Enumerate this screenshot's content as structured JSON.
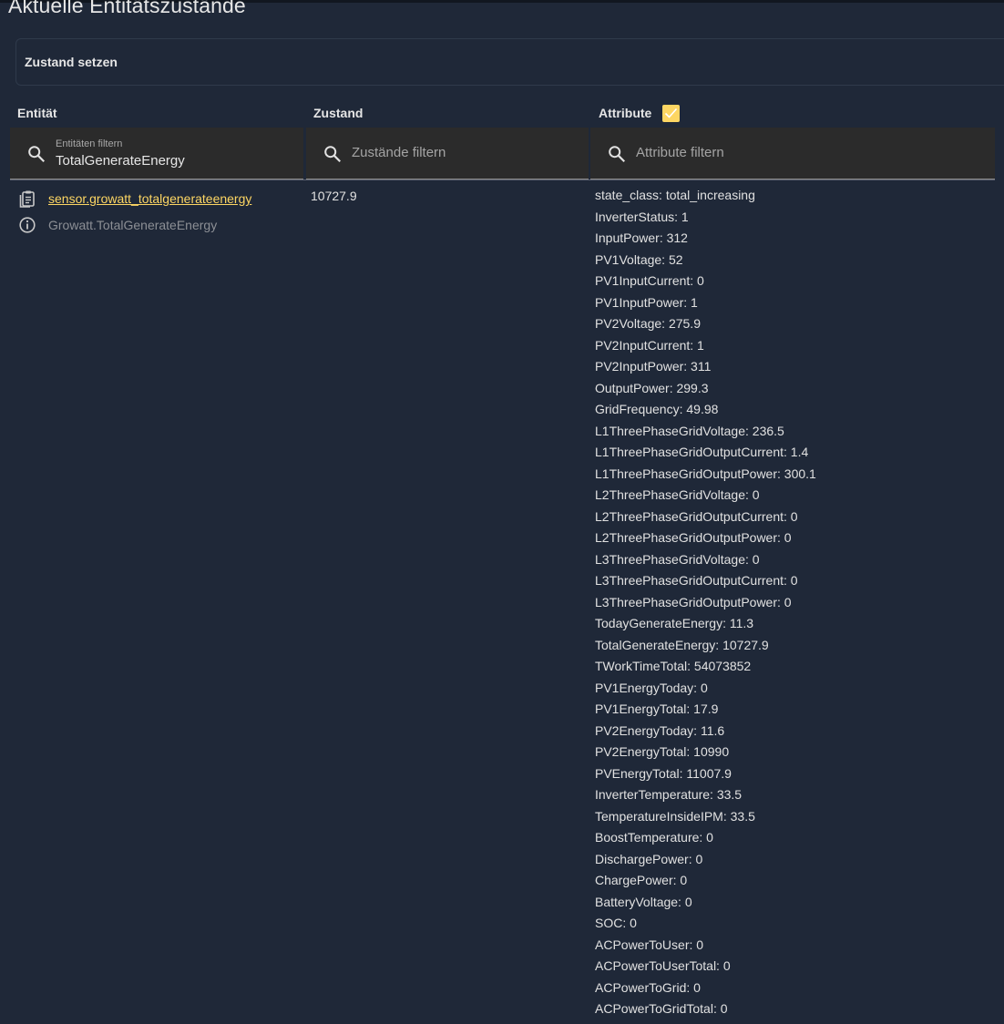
{
  "page": {
    "title": "Aktuelle Entitätszustände"
  },
  "set_state": {
    "label": "Zustand setzen"
  },
  "columns": {
    "entity": "Entität",
    "state": "Zustand",
    "attributes": "Attribute",
    "attributes_checked": true
  },
  "filters": {
    "entity": {
      "label": "Entitäten filtern",
      "value": "TotalGenerateEnergy"
    },
    "state": {
      "placeholder": "Zustände filtern"
    },
    "attributes": {
      "placeholder": "Attribute filtern"
    }
  },
  "colors": {
    "accent": "#fdd663",
    "background": "#1f2838",
    "filter_bg": "#2b2b2b"
  },
  "entity_row": {
    "entity_id": "sensor.growatt_totalgenerateenergy",
    "friendly_name": "Growatt.TotalGenerateEnergy",
    "state": "10727.9",
    "icons": [
      "clipboard-icon",
      "info-icon"
    ],
    "attributes": [
      "state_class: total_increasing",
      "InverterStatus: 1",
      "InputPower: 312",
      "PV1Voltage: 52",
      "PV1InputCurrent: 0",
      "PV1InputPower: 1",
      "PV2Voltage: 275.9",
      "PV2InputCurrent: 1",
      "PV2InputPower: 311",
      "OutputPower: 299.3",
      "GridFrequency: 49.98",
      "L1ThreePhaseGridVoltage: 236.5",
      "L1ThreePhaseGridOutputCurrent: 1.4",
      "L1ThreePhaseGridOutputPower: 300.1",
      "L2ThreePhaseGridVoltage: 0",
      "L2ThreePhaseGridOutputCurrent: 0",
      "L2ThreePhaseGridOutputPower: 0",
      "L3ThreePhaseGridVoltage: 0",
      "L3ThreePhaseGridOutputCurrent: 0",
      "L3ThreePhaseGridOutputPower: 0",
      "TodayGenerateEnergy: 11.3",
      "TotalGenerateEnergy: 10727.9",
      "TWorkTimeTotal: 54073852",
      "PV1EnergyToday: 0",
      "PV1EnergyTotal: 17.9",
      "PV2EnergyToday: 11.6",
      "PV2EnergyTotal: 10990",
      "PVEnergyTotal: 11007.9",
      "InverterTemperature: 33.5",
      "TemperatureInsideIPM: 33.5",
      "BoostTemperature: 0",
      "DischargePower: 0",
      "ChargePower: 0",
      "BatteryVoltage: 0",
      "SOC: 0",
      "ACPowerToUser: 0",
      "ACPowerToUserTotal: 0",
      "ACPowerToGrid: 0",
      "ACPowerToGridTotal: 0"
    ]
  }
}
